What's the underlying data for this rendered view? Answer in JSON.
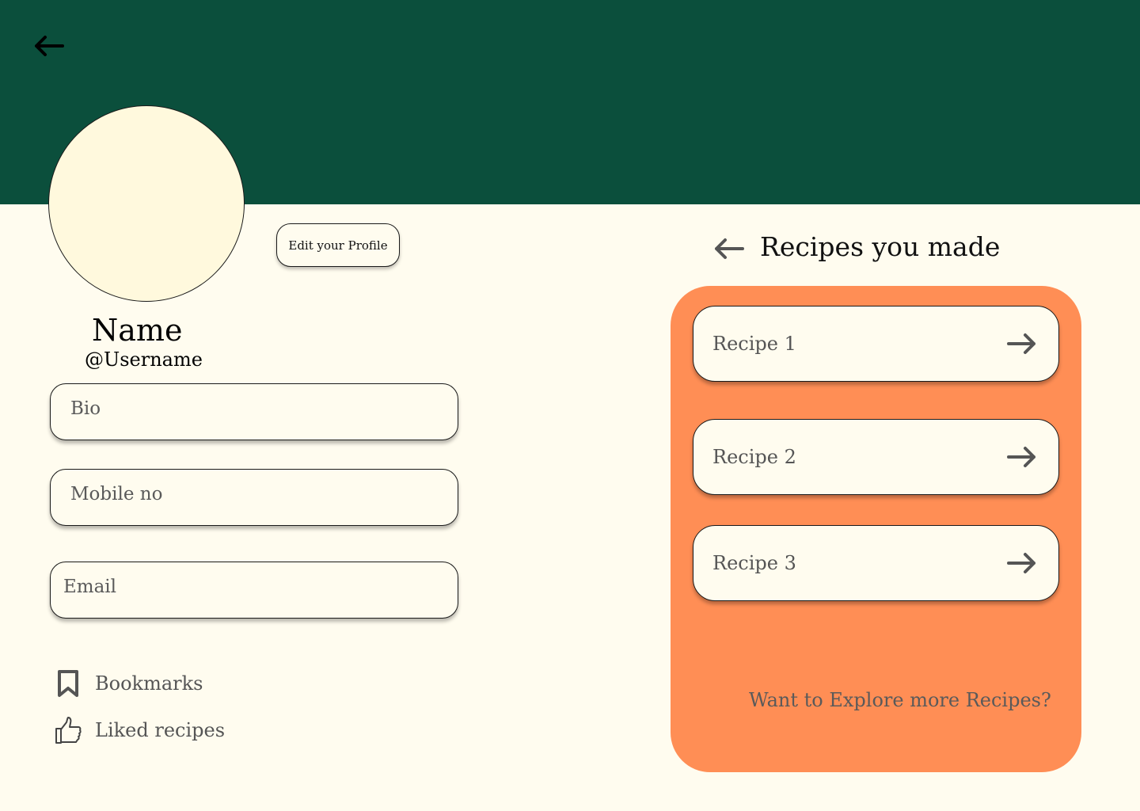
{
  "colors": {
    "header": "#0B4F3C",
    "background": "#FFFCEF",
    "avatar": "#FFF9DD",
    "panel": "#FF8E55"
  },
  "header": {
    "back_icon": "arrow-left-icon"
  },
  "profile": {
    "edit_label": "Edit your Profile",
    "name": "Name",
    "username": "@Username"
  },
  "fields": {
    "bio_placeholder": "Bio",
    "mobile_placeholder": "Mobile no",
    "email_placeholder": "Email"
  },
  "links": {
    "bookmarks": {
      "label": "Bookmarks",
      "icon": "bookmark-icon"
    },
    "liked": {
      "label": "Liked recipes",
      "icon": "thumbs-up-icon"
    }
  },
  "recipes": {
    "back_icon": "arrow-left-icon",
    "title": "Recipes you made",
    "items": [
      {
        "label": "Recipe 1",
        "icon": "arrow-right-icon"
      },
      {
        "label": "Recipe 2",
        "icon": "arrow-right-icon"
      },
      {
        "label": "Recipe 3",
        "icon": "arrow-right-icon"
      }
    ],
    "explore": "Want to Explore more Recipes?"
  }
}
